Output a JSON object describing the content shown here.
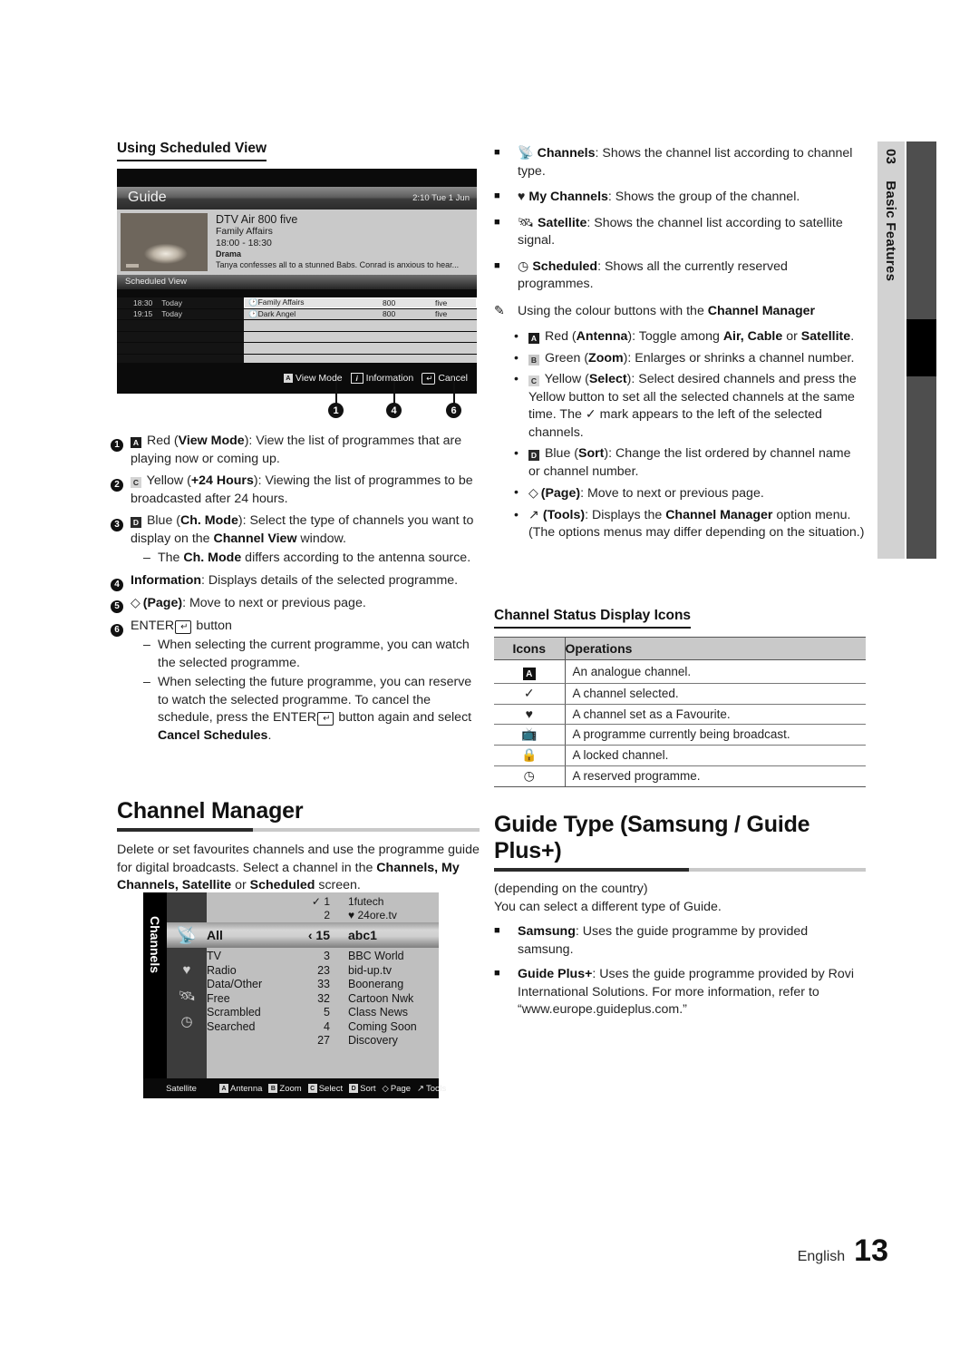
{
  "side_tab": {
    "chapter_number": "03",
    "chapter_title": "Basic Features"
  },
  "footer": {
    "language": "English",
    "page_number": "13"
  },
  "left_column": {
    "heading": "Using Scheduled View",
    "guide_screenshot": {
      "title": "Guide",
      "clock": "2:10 Tue 1 Jun",
      "info": {
        "channel": "DTV Air 800 five",
        "programme": "Family Affairs",
        "time": "18:00 - 18:30",
        "genre": "Drama",
        "description": "Tanya confesses all to a stunned Babs. Conrad is anxious to hear..."
      },
      "section_label": "Scheduled View",
      "rows": [
        {
          "time": "18:30",
          "day": "Today",
          "name": "Family Affairs",
          "channel": "800",
          "broadcaster": "five",
          "selected": true
        },
        {
          "time": "19:15",
          "day": "Today",
          "name": "Dark Angel",
          "channel": "800",
          "broadcaster": "five",
          "selected": false
        }
      ],
      "empty_rows": 4,
      "footer_keys": [
        {
          "key": "A",
          "label": "View Mode"
        },
        {
          "key": "i",
          "label": "Information"
        },
        {
          "key": "enter",
          "label": "Cancel"
        }
      ]
    },
    "callouts": [
      "1",
      "4",
      "6"
    ],
    "numbered_items": [
      {
        "num": "1",
        "key": "A",
        "key_color": "red",
        "parts": [
          {
            "t": "Red (",
            "b": false
          },
          {
            "t": "View Mode",
            "b": true
          },
          {
            "t": "): View the list of programmes that are playing now or coming up.",
            "b": false
          }
        ],
        "subitems": []
      },
      {
        "num": "2",
        "key": "C",
        "key_color": "yellow",
        "parts": [
          {
            "t": "Yellow (",
            "b": false
          },
          {
            "t": "+24 Hours",
            "b": true
          },
          {
            "t": "): Viewing the list of programmes to be broadcasted after 24 hours.",
            "b": false
          }
        ],
        "subitems": []
      },
      {
        "num": "3",
        "key": "D",
        "key_color": "blue",
        "parts": [
          {
            "t": "Blue (",
            "b": false
          },
          {
            "t": "Ch. Mode",
            "b": true
          },
          {
            "t": "): Select the type of channels you want to display on the ",
            "b": false
          },
          {
            "t": "Channel View",
            "b": true
          },
          {
            "t": " window.",
            "b": false
          }
        ],
        "subitems": [
          [
            {
              "t": "The ",
              "b": false
            },
            {
              "t": "Ch. Mode",
              "b": true
            },
            {
              "t": " differs according to the antenna source.",
              "b": false
            }
          ]
        ]
      },
      {
        "num": "4",
        "key": "",
        "key_color": "",
        "parts": [
          {
            "t": "Information",
            "b": true
          },
          {
            "t": ": Displays details of the selected programme.",
            "b": false
          }
        ],
        "subitems": []
      },
      {
        "num": "5",
        "key": "page",
        "key_color": "",
        "parts": [
          {
            "t": "(Page)",
            "b": true
          },
          {
            "t": ": Move to next or previous page.",
            "b": false
          }
        ],
        "subitems": []
      },
      {
        "num": "6",
        "key": "enter",
        "key_color": "",
        "parts": [
          {
            "t": "ENTER",
            "b": false
          },
          {
            "t": "E",
            "b": false
          },
          {
            "t": " button",
            "b": false
          }
        ],
        "subitems": [
          [
            {
              "t": "When selecting the current programme, you can watch the selected programme.",
              "b": false
            }
          ],
          [
            {
              "t": "When selecting the future programme, you can reserve to watch the selected programme. To cancel the schedule, press the ENTER",
              "b": false
            },
            {
              "t": "E",
              "b": false
            },
            {
              "t": " button again and select ",
              "b": false
            },
            {
              "t": "Cancel Schedules",
              "b": true
            },
            {
              "t": ".",
              "b": false
            }
          ]
        ]
      }
    ],
    "channel_manager": {
      "heading": "Channel Manager",
      "intro_parts": [
        {
          "t": "Delete or set favourites channels and use the programme guide for digital broadcasts. Select a channel in the ",
          "b": false
        },
        {
          "t": "Channels, My Channels, Satellite",
          "b": true
        },
        {
          "t": " or ",
          "b": false
        },
        {
          "t": "Scheduled",
          "b": true
        },
        {
          "t": " screen.",
          "b": false
        }
      ],
      "screenshot": {
        "vertical_tab": "Channels",
        "sidebar_icons": [
          "satellite-dish-icon",
          "heart-icon",
          "satellite-icon",
          "clock-icon"
        ],
        "header_rows": [
          {
            "mark": "check",
            "number": "1",
            "fav": "",
            "name": "1futech"
          },
          {
            "mark": "",
            "number": "2",
            "fav": "heart",
            "name": "24ore.tv"
          }
        ],
        "selected_row": {
          "category": "All",
          "number": "15",
          "name": "abc1"
        },
        "categories": [
          "TV",
          "Radio",
          "Data/Other",
          "Free",
          "Scrambled",
          "Searched"
        ],
        "channel_numbers": [
          "3",
          "23",
          "33",
          "32",
          "5",
          "4",
          "27"
        ],
        "channel_names": [
          "BBC World",
          "bid-up.tv",
          "Boonerang",
          "Cartoon Nwk",
          "Class News",
          "Coming Soon",
          "Discovery"
        ],
        "footer_source": "Satellite",
        "footer_keys": [
          {
            "key": "A",
            "color": "red",
            "label": "Antenna"
          },
          {
            "key": "B",
            "color": "green",
            "label": "Zoom"
          },
          {
            "key": "C",
            "color": "yellow",
            "label": "Select"
          },
          {
            "key": "D",
            "color": "blue",
            "label": "Sort"
          },
          {
            "key": "page",
            "color": "",
            "label": "Page"
          },
          {
            "key": "tools",
            "color": "",
            "label": "Tools"
          }
        ]
      }
    }
  },
  "right_column": {
    "screen_items": [
      {
        "icon": "channels-icon",
        "parts": [
          {
            "t": "Channels",
            "b": true
          },
          {
            "t": ": Shows the channel list according to channel type.",
            "b": false
          }
        ]
      },
      {
        "icon": "heart-icon",
        "parts": [
          {
            "t": "My Channels",
            "b": true
          },
          {
            "t": ": Shows the group of the channel.",
            "b": false
          }
        ]
      },
      {
        "icon": "satellite-icon",
        "parts": [
          {
            "t": "Satellite",
            "b": true
          },
          {
            "t": ": Shows the channel list according to satellite signal.",
            "b": false
          }
        ]
      },
      {
        "icon": "clock-icon",
        "parts": [
          {
            "t": "Scheduled",
            "b": true
          },
          {
            "t": ": Shows all the currently reserved programmes.",
            "b": false
          }
        ]
      }
    ],
    "note_heading_parts": [
      {
        "t": "Using the colour buttons with the ",
        "b": false
      },
      {
        "t": "Channel Manager",
        "b": true
      }
    ],
    "colour_bullets": [
      {
        "key": "A",
        "key_color": "red",
        "parts": [
          {
            "t": "Red (",
            "b": false
          },
          {
            "t": "Antenna",
            "b": true
          },
          {
            "t": "): Toggle among ",
            "b": false
          },
          {
            "t": "Air, Cable",
            "b": true
          },
          {
            "t": " or ",
            "b": false
          },
          {
            "t": "Satellite",
            "b": true
          },
          {
            "t": ".",
            "b": false
          }
        ]
      },
      {
        "key": "B",
        "key_color": "green",
        "parts": [
          {
            "t": "Green (",
            "b": false
          },
          {
            "t": "Zoom",
            "b": true
          },
          {
            "t": "): Enlarges or shrinks a channel number.",
            "b": false
          }
        ]
      },
      {
        "key": "C",
        "key_color": "yellow",
        "parts": [
          {
            "t": "Yellow (",
            "b": false
          },
          {
            "t": "Select",
            "b": true
          },
          {
            "t": "): Select desired channels and press the Yellow button to set all the selected channels at the same time. The ✓ mark appears to the left of the selected channels.",
            "b": false
          }
        ]
      },
      {
        "key": "D",
        "key_color": "blue",
        "parts": [
          {
            "t": "Blue (",
            "b": false
          },
          {
            "t": "Sort",
            "b": true
          },
          {
            "t": "): Change the list ordered by channel name or channel number.",
            "b": false
          }
        ]
      },
      {
        "key": "page",
        "key_color": "",
        "parts": [
          {
            "t": "(Page)",
            "b": true
          },
          {
            "t": ": Move to next or previous page.",
            "b": false
          }
        ]
      },
      {
        "key": "tools",
        "key_color": "",
        "parts": [
          {
            "t": "(Tools)",
            "b": true
          },
          {
            "t": ": Displays the ",
            "b": false
          },
          {
            "t": "Channel Manager",
            "b": true
          },
          {
            "t": " option menu. (The options menus may differ depending on the situation.)",
            "b": false
          }
        ]
      }
    ],
    "status_table": {
      "heading": "Channel Status Display Icons",
      "columns": [
        "Icons",
        "Operations"
      ],
      "rows": [
        {
          "icon": "analogue-A-icon",
          "glyph": "A",
          "operation": "An analogue channel."
        },
        {
          "icon": "check-icon",
          "glyph": "✓",
          "operation": "A channel selected."
        },
        {
          "icon": "heart-icon",
          "glyph": "♥",
          "operation": "A channel set as a Favourite."
        },
        {
          "icon": "tv-icon",
          "glyph": "tv",
          "operation": "A programme currently being broadcast."
        },
        {
          "icon": "lock-icon",
          "glyph": "lock",
          "operation": "A locked channel."
        },
        {
          "icon": "clock-icon",
          "glyph": "◴",
          "operation": "A reserved programme."
        }
      ]
    },
    "guide_type": {
      "heading": "Guide Type (Samsung / Guide Plus+)",
      "subnote": "(depending on the country)",
      "intro": "You can select a different type of Guide.",
      "items": [
        {
          "parts": [
            {
              "t": "Samsung",
              "b": true
            },
            {
              "t": ": Uses the guide programme by provided samsung.",
              "b": false
            }
          ]
        },
        {
          "parts": [
            {
              "t": "Guide Plus+",
              "b": true
            },
            {
              "t": ": Uses the guide programme provided by Rovi International Solutions. For more information, refer to “www.europe.guideplus.com.”",
              "b": false
            }
          ]
        }
      ]
    }
  }
}
